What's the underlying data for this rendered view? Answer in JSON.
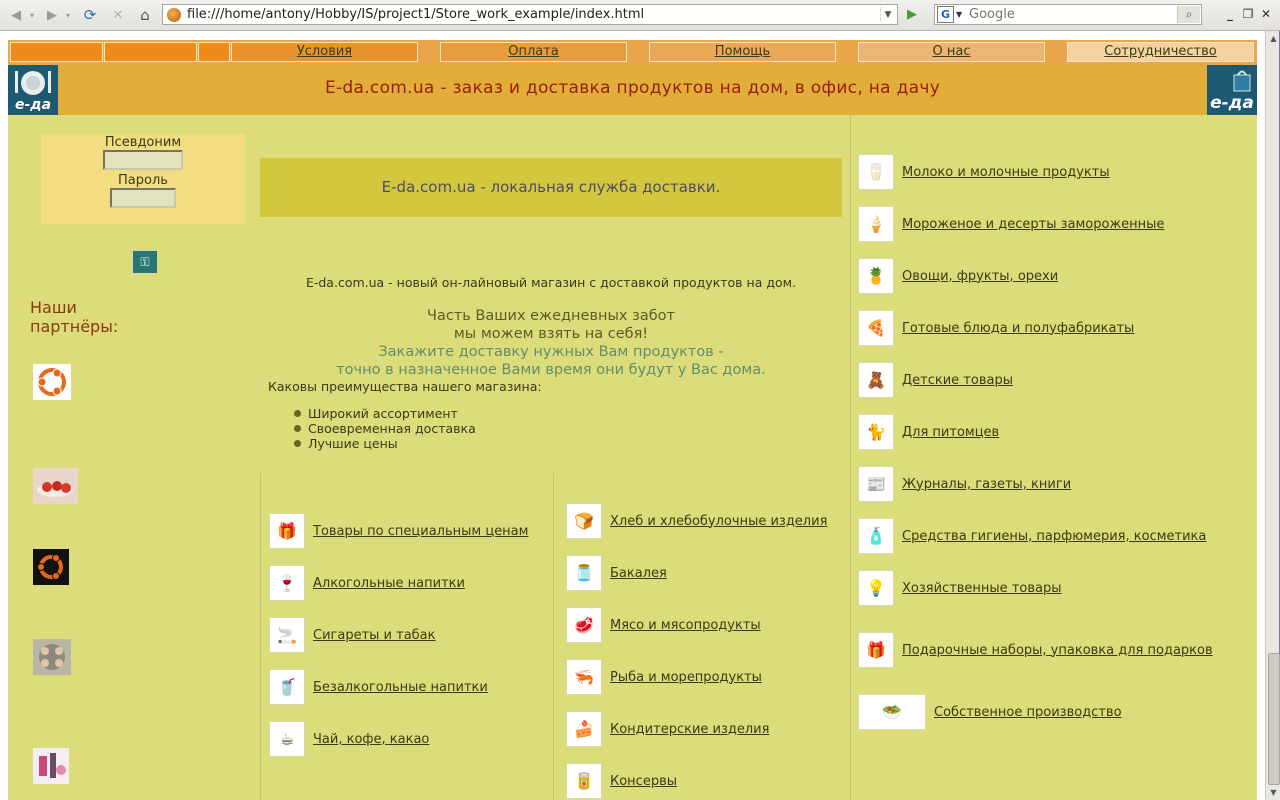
{
  "browser": {
    "url": "file:///home/antony/Hobby/IS/project1/Store_work_example/index.html",
    "search_placeholder": "Google",
    "search_engine_letter": "G"
  },
  "site": {
    "nav": [
      "Условия",
      "Оплата",
      "Помощь",
      "О нас",
      "Сотрудничество"
    ],
    "banner_title": "E-da.com.ua - заказ и доставка продуктов на дом, в офис, на дачу",
    "logo_text": "е-да"
  },
  "login": {
    "nick_label": "Псевдоним",
    "password_label": "Пароль"
  },
  "partners": {
    "title_line1": "Наши",
    "title_line2": "партнёры:"
  },
  "center": {
    "box_title": "E-da.com.ua - локальная служба доставки.",
    "intro": "E-da.com.ua - новый он-лайновый магазин с доставкой продуктов на дом.",
    "promo_line1": "Часть Ваших ежедневных забот",
    "promo_line2": "мы можем взять на себя!",
    "promo_line3": "Закажите доставку нужных Вам продуктов -",
    "promo_line4": "точно в назначенное Вами время они будут у Вас дома.",
    "advantages_title": "Каковы преимущества нашего магазина:",
    "advantages": [
      "Широкий ассортимент",
      "Своевременная доставка",
      "Лучшие цены"
    ]
  },
  "categories_left": [
    "Товары по специальным ценам",
    "Алкогольные напитки",
    "Сигареты и табак",
    "Безалкогольные напитки",
    "Чай, кофе, какао"
  ],
  "categories_mid": [
    "Хлеб и хлебобулочные изделия",
    "Бакалея",
    "Мясо и мясопродукты",
    "Рыба и морепродукты",
    "Кондитерские изделия",
    "Консервы"
  ],
  "categories_right": [
    "Молоко и молочные продукты",
    "Мороженое и десерты замороженные",
    "Овощи, фрукты, орехи",
    "Готовые блюда и полуфабрикаты",
    "Детские товары",
    "Для питомцев",
    "Журналы, газеты, книги",
    "Средства гигиены, парфюмерия, косметика",
    "Хозяйственные товары",
    "Подарочные наборы, упаковка для подарков",
    "Собственное производство"
  ],
  "colors": {
    "page_bg": "#dcdc7a",
    "banner_bg": "#e2ae3a",
    "banner_text": "#9a1d0a",
    "nav_bg": "#e9a64b",
    "promo_brown": "#5e5a26",
    "promo_green": "#5f8f6a"
  }
}
